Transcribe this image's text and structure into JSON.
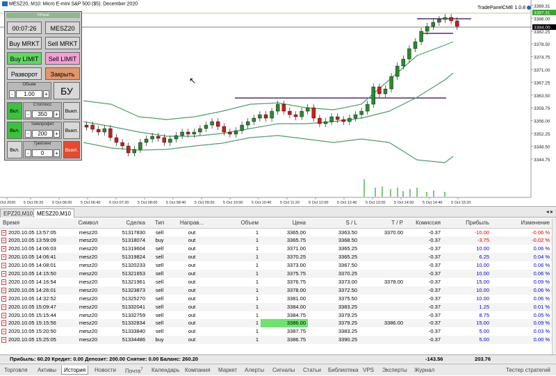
{
  "chart": {
    "title": "MESZ20, M10:  Micro E-mini S&P 500 ($5): December 2020",
    "panel_indicator": "TradePanelCME 1.0.8",
    "price_labels": [
      "3389.31",
      "3386.00",
      "3382.25",
      "3378.50",
      "3374.75",
      "3371.00",
      "3367.25",
      "3363.50",
      "3359.75",
      "3356.00",
      "3352.25",
      "3348.50",
      "3344.75"
    ],
    "price_marker_top": "3387.31",
    "price_marker_current": "3384.00",
    "time_labels": [
      "Oct 2020",
      "5 Oct 05:20",
      "5 Oct 06:00",
      "5 Oct 06:40",
      "5 Oct 07:20",
      "5 Oct 08:00",
      "5 Oct 08:40",
      "5 Oct 09:20",
      "5 Oct 10:00",
      "5 Oct 10:40",
      "5 Oct 11:20",
      "5 Oct 12:00",
      "5 Oct 12:40",
      "5 Oct 13:20",
      "5 Oct 14:00",
      "5 Oct 14:40",
      "5 Oct 15:20"
    ]
  },
  "panel": {
    "header": "TrPanel",
    "time": "00:07:26",
    "symbol": "MESZ20",
    "buy_mrkt": "Buy MRKT",
    "sell_mrkt": "Sell MRKT",
    "buy_limit": "Buy LIMIT",
    "sell_limit": "Sell LIMIT",
    "reverse": "Разворот",
    "close": "Закрыть",
    "volume_label": "Объем",
    "volume_value": "1.00",
    "be": "БУ",
    "on": "Вкл.",
    "off": "Выкл.",
    "stoploss_label": "Стоплосс",
    "stoploss_value": "350",
    "takeprofit_label": "Тейкпрофит",
    "takeprofit_value": "200",
    "trailing_label": "Трейлинг",
    "trailing_value": "0",
    "minus": "-",
    "plus": "+"
  },
  "chart_tabs": [
    "EPZ20,M10",
    "MESZ20,M10"
  ],
  "table": {
    "headers": [
      "Время",
      "Символ",
      "Сделка",
      "Тип",
      "Направ...",
      "Объем",
      "Цена",
      "S / L",
      "T / P",
      "Комиссия",
      "Прибыль",
      "Изменение"
    ],
    "rows": [
      [
        "2020.10.05 13:57:05",
        "mesz20",
        "51317830",
        "sell",
        "out",
        "1",
        "3365.00",
        "3363.50",
        "3370.00",
        "-0.37",
        "-10.00",
        "-0.06 %"
      ],
      [
        "2020.10.05 13:59:09",
        "mesz20",
        "51318074",
        "buy",
        "out",
        "1",
        "3365.75",
        "3368.50",
        "",
        "-0.37",
        "-3.75",
        "-0.02 %"
      ],
      [
        "2020.10.05 14:06:03",
        "mesz20",
        "51319604",
        "sell",
        "out",
        "1",
        "3371.00",
        "3365.25",
        "",
        "-0.37",
        "10.00",
        "0.06 %"
      ],
      [
        "2020.10.05 14:06:41",
        "mesz20",
        "51319824",
        "sell",
        "out",
        "1",
        "3370.25",
        "3365.25",
        "",
        "-0.37",
        "6.25",
        "0.04 %"
      ],
      [
        "2020.10.05 14:08:01",
        "mesz20",
        "51320233",
        "sell",
        "out",
        "1",
        "3373.00",
        "3367.50",
        "",
        "-0.37",
        "10.00",
        "0.06 %"
      ],
      [
        "2020.10.05 14:15:50",
        "mesz20",
        "51321653",
        "sell",
        "out",
        "1",
        "3375.75",
        "3370.25",
        "",
        "-0.37",
        "10.00",
        "0.06 %"
      ],
      [
        "2020.10.05 14:16:54",
        "mesz20",
        "51321961",
        "sell",
        "out",
        "1",
        "3376.75",
        "3373.00",
        "3378.00",
        "-0.37",
        "15.00",
        "0.09 %"
      ],
      [
        "2020.10.05 14:26:01",
        "mesz20",
        "51323873",
        "sell",
        "out",
        "1",
        "3378.00",
        "3372.50",
        "",
        "-0.37",
        "10.00",
        "0.06 %"
      ],
      [
        "2020.10.05 14:32:52",
        "mesz20",
        "51325270",
        "sell",
        "out",
        "1",
        "3381.00",
        "3375.50",
        "",
        "-0.37",
        "10.00",
        "0.06 %"
      ],
      [
        "2020.10.05 15:09:47",
        "mesz20",
        "51332041",
        "sell",
        "out",
        "1",
        "3384.00",
        "3383.25",
        "",
        "-0.37",
        "1.25",
        "0.01 %"
      ],
      [
        "2020.10.05 15:15:44",
        "mesz20",
        "51332759",
        "sell",
        "out",
        "1",
        "3384.75",
        "3379.25",
        "",
        "-0.37",
        "8.75",
        "0.05 %"
      ],
      [
        "2020.10.05 15:15:56",
        "mesz20",
        "51332834",
        "sell",
        "out",
        "1",
        "3386.00",
        "3379.25",
        "3386.00",
        "-0.37",
        "15.00",
        "0.09 %"
      ],
      [
        "2020.10.05 15:20:50",
        "mesz20",
        "51333840",
        "sell",
        "out",
        "1",
        "3387.75",
        "3383.25",
        "",
        "-0.37",
        "5.00",
        "0.03 %"
      ],
      [
        "2020.10.05 15:25:05",
        "mesz20",
        "51334486",
        "buy",
        "out",
        "1",
        "3386.75",
        "3390.25",
        "",
        "-0.37",
        "5.00",
        "0.00 %"
      ]
    ]
  },
  "summary": {
    "text": "Прибыль: 60.20  Кредит: 0.00  Депозит: 200.00  Снятие: 0.00  Баланс: 260.20",
    "commission_total": "-143.56",
    "profit_total": "203.76"
  },
  "bottom_tabs": [
    "Торговля",
    "Активы",
    "История",
    "Новости",
    "Почта",
    "Календарь",
    "Компания",
    "Маркет",
    "Алерты",
    "Сигналы",
    "Статьи",
    "Библиотека",
    "VPS",
    "Эксперты",
    "Журнал"
  ],
  "mail_badge": "7",
  "tester": "Тестер стратегий",
  "colors": {
    "bull": "#2b8a2b",
    "bear": "#d11a1a",
    "band": "#48a06a",
    "profit_positive": "#0000cc",
    "profit_negative": "#dd0000",
    "highlight": "#6ee26e"
  }
}
